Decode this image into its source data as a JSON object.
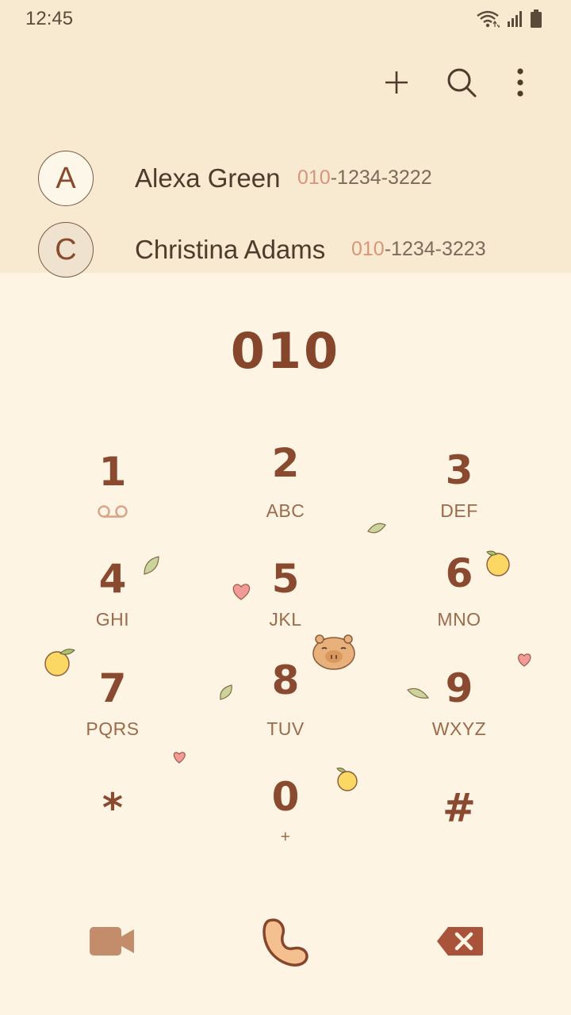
{
  "status_bar": {
    "time": "12:45",
    "icons": [
      "wifi-icon",
      "signal-icon",
      "battery-icon"
    ]
  },
  "toolbar": {
    "add_icon": "plus-icon",
    "search_icon": "search-icon",
    "more_icon": "more-vertical-icon"
  },
  "contacts": [
    {
      "initial": "A",
      "name": "Alexa Green",
      "number_match": "010",
      "number_rest": "-1234-3222"
    },
    {
      "initial": "C",
      "name": "Christina Adams",
      "number_match": "010",
      "number_rest": "-1234-3223"
    }
  ],
  "dialer": {
    "number": "010"
  },
  "keypad": [
    {
      "digit": "1",
      "letters": ""
    },
    {
      "digit": "2",
      "letters": "ABC"
    },
    {
      "digit": "3",
      "letters": "DEF"
    },
    {
      "digit": "4",
      "letters": "GHI"
    },
    {
      "digit": "5",
      "letters": "JKL"
    },
    {
      "digit": "6",
      "letters": "MNO"
    },
    {
      "digit": "7",
      "letters": "PQRS"
    },
    {
      "digit": "8",
      "letters": "TUV"
    },
    {
      "digit": "9",
      "letters": "WXYZ"
    },
    {
      "digit": "*",
      "letters": ""
    },
    {
      "digit": "0",
      "letters": "+"
    },
    {
      "digit": "#",
      "letters": ""
    }
  ],
  "bottom_actions": [
    "video-call-icon",
    "phone-call-icon",
    "backspace-icon"
  ],
  "colors": {
    "top_background": "#f7ead1",
    "keypad_background": "#fdf4e3",
    "accent_brown": "#86462c",
    "match_highlight": "#d9957a"
  }
}
